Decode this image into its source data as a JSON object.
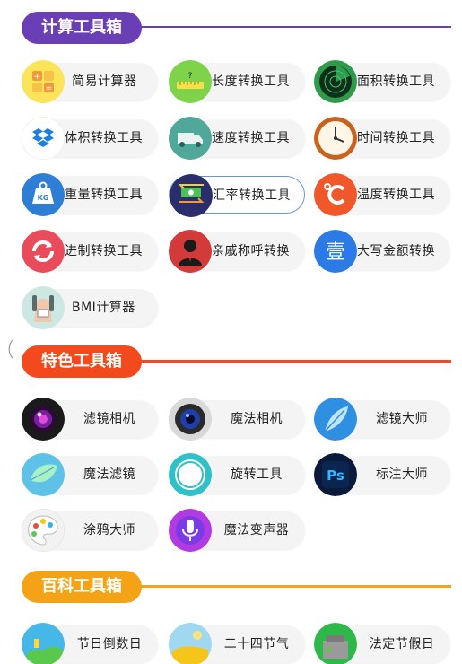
{
  "sections": [
    {
      "title": "计算工具箱",
      "color": "#6a3fb5",
      "tools": [
        {
          "label": "简易计算器",
          "icon": "calculator-icon"
        },
        {
          "label": "长度转换工具",
          "icon": "ruler-icon"
        },
        {
          "label": "面积转换工具",
          "icon": "radar-icon"
        },
        {
          "label": "体积转换工具",
          "icon": "box-icon"
        },
        {
          "label": "速度转换工具",
          "icon": "truck-icon"
        },
        {
          "label": "时间转换工具",
          "icon": "clock-icon"
        },
        {
          "label": "重量转换工具",
          "icon": "weight-icon"
        },
        {
          "label": "汇率转换工具",
          "icon": "exchange-icon",
          "selected": true
        },
        {
          "label": "温度转换工具",
          "icon": "celsius-icon"
        },
        {
          "label": "进制转换工具",
          "icon": "cycle-icon"
        },
        {
          "label": "亲戚称呼转换",
          "icon": "person-icon"
        },
        {
          "label": "大写金额转换",
          "icon": "chinese-numeral-icon"
        },
        {
          "label": "BMI计算器",
          "icon": "body-scale-icon"
        }
      ]
    },
    {
      "title": "特色工具箱",
      "color": "#f24a1c",
      "tools": [
        {
          "label": "滤镜相机",
          "icon": "camera-lens-icon"
        },
        {
          "label": "魔法相机",
          "icon": "camera-lens-blue-icon"
        },
        {
          "label": "滤镜大师",
          "icon": "feather-icon"
        },
        {
          "label": "魔法滤镜",
          "icon": "leaf-icon"
        },
        {
          "label": "旋转工具",
          "icon": "rotate-ring-icon"
        },
        {
          "label": "标注大师",
          "icon": "photoshop-icon",
          "icon_text": "Ps"
        },
        {
          "label": "涂鸦大师",
          "icon": "palette-icon"
        },
        {
          "label": "魔法变声器",
          "icon": "microphone-icon"
        }
      ]
    },
    {
      "title": "百科工具箱",
      "color": "#f5a316",
      "tools": [
        {
          "label": "节日倒数日",
          "icon": "festival-icon"
        },
        {
          "label": "二十四节气",
          "icon": "solar-term-icon"
        },
        {
          "label": "法定节假日",
          "icon": "holiday-icon"
        }
      ]
    }
  ]
}
